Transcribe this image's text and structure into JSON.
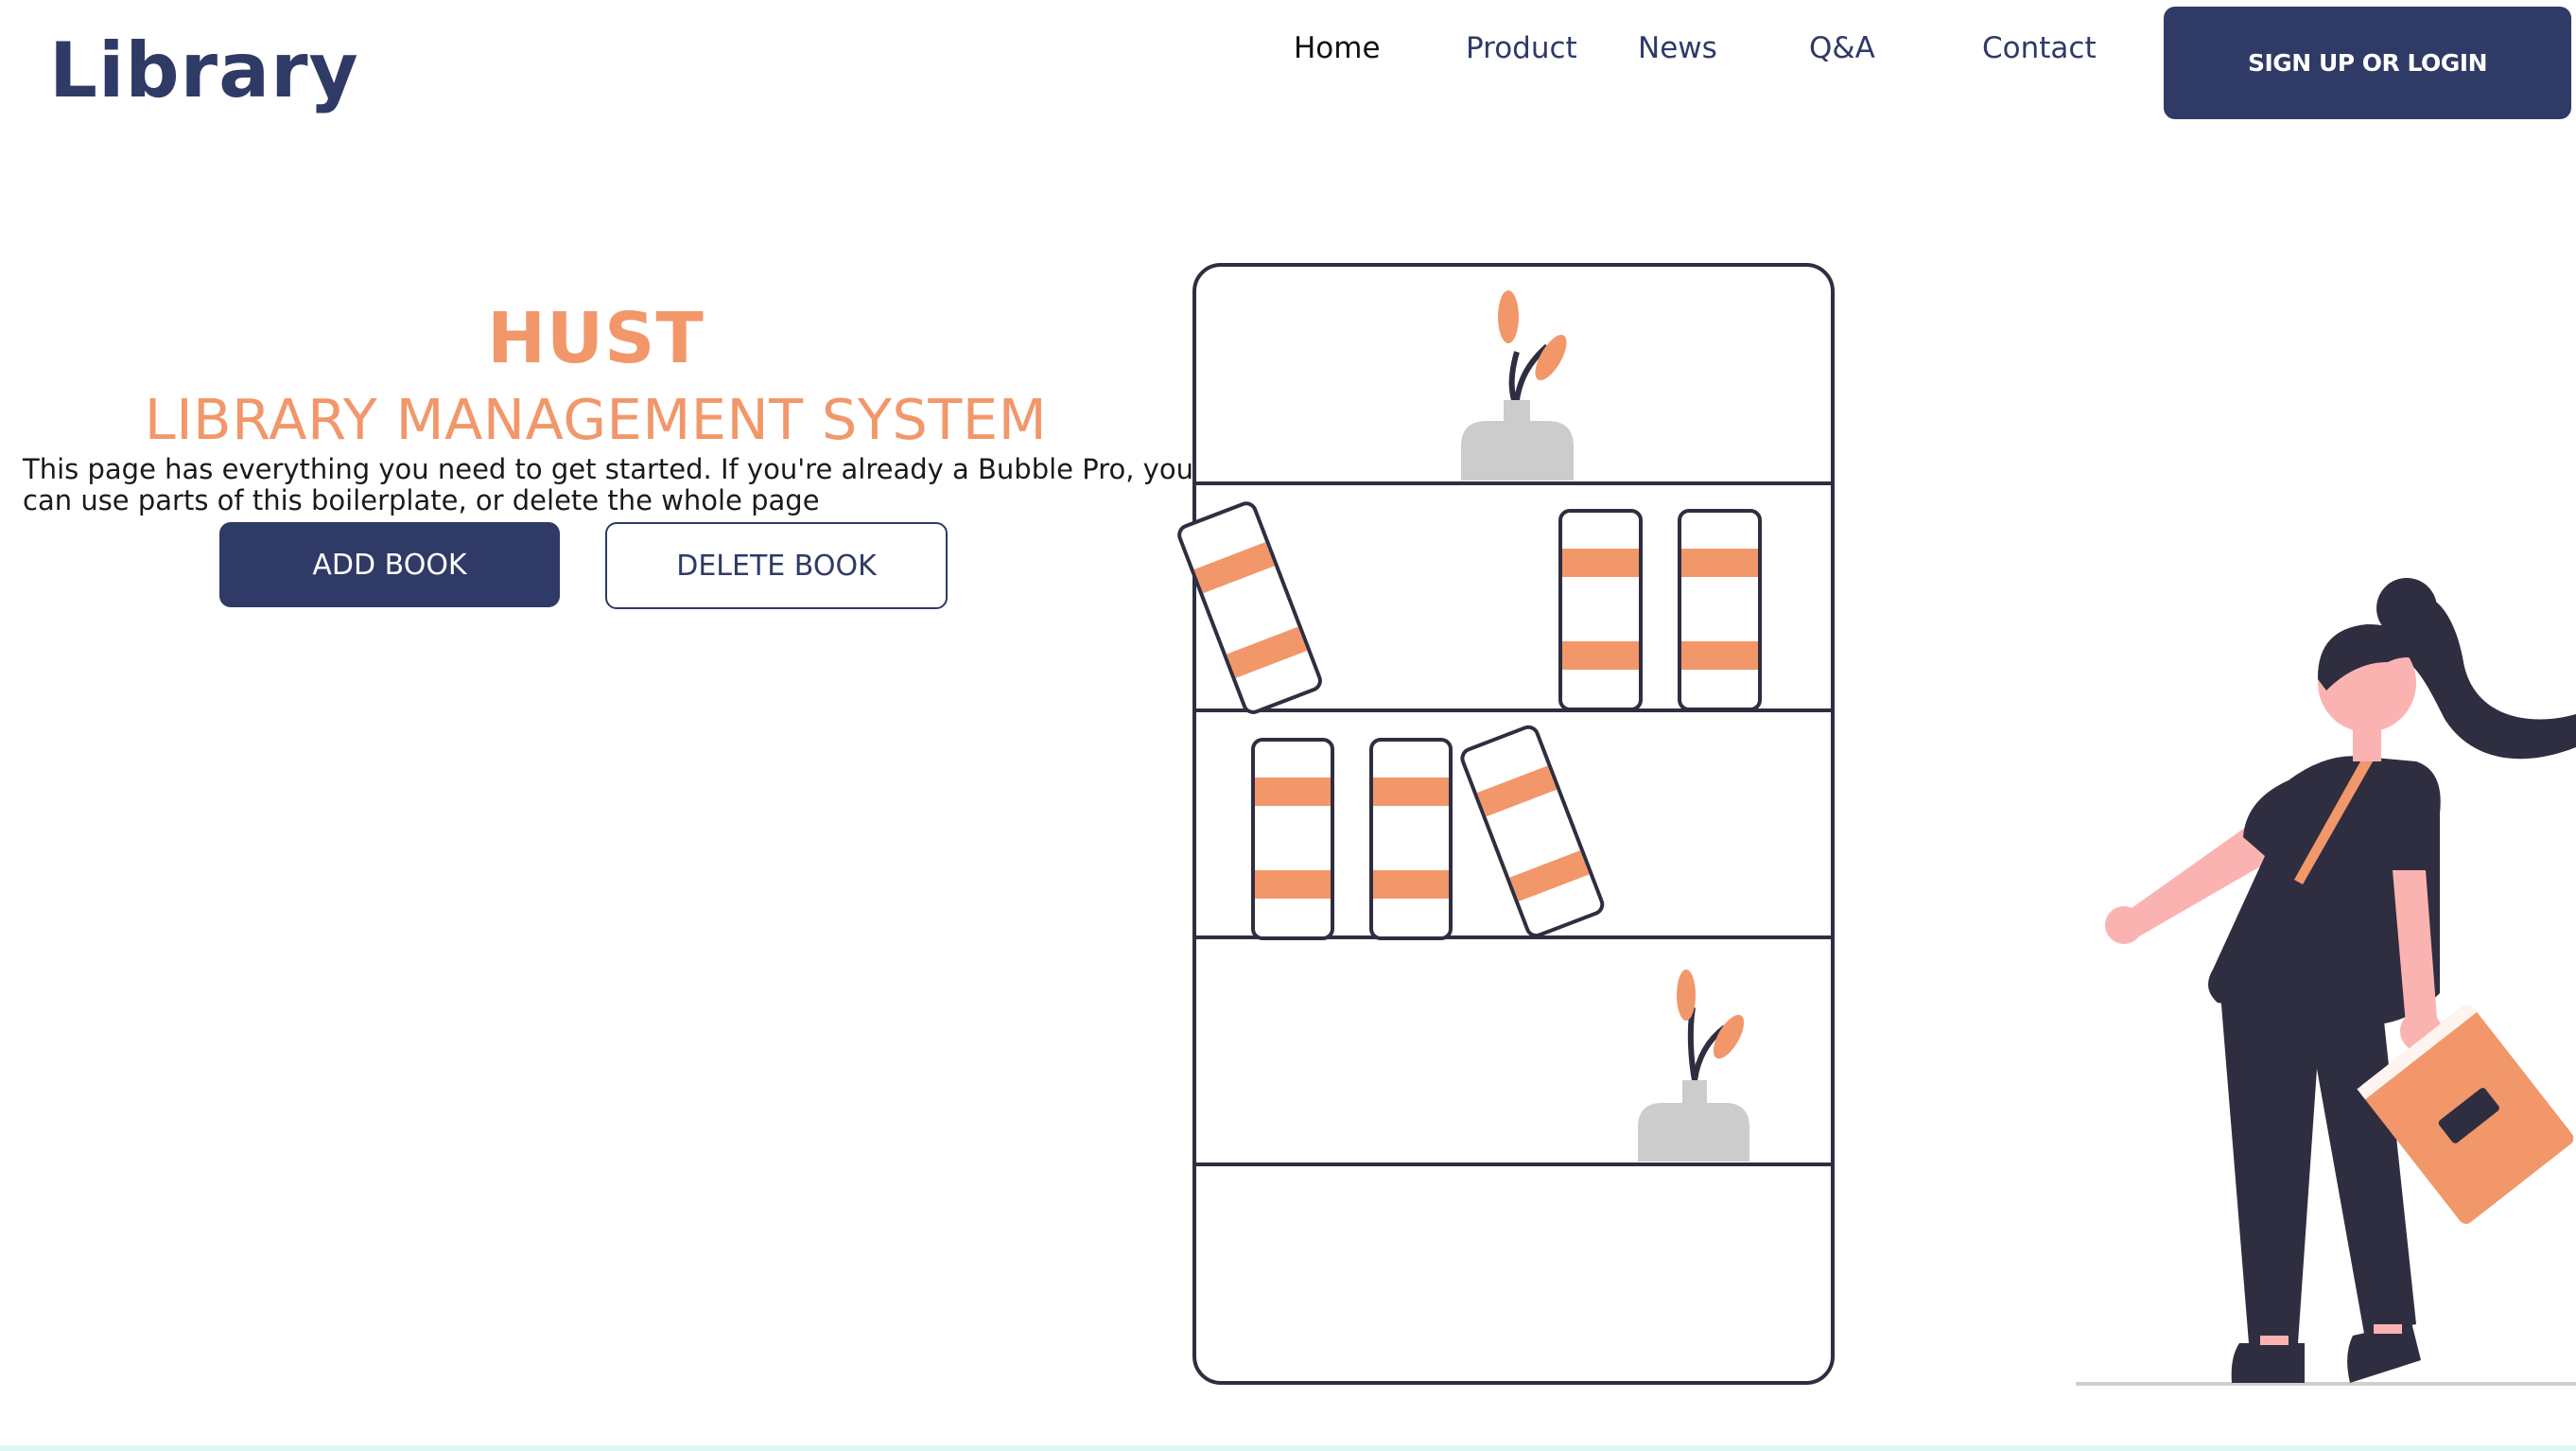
{
  "header": {
    "logo": "Library",
    "nav": [
      {
        "label": "Home",
        "active": true
      },
      {
        "label": "Product",
        "active": false
      },
      {
        "label": "News",
        "active": false
      },
      {
        "label": "Q&A",
        "active": false
      },
      {
        "label": "Contact",
        "active": false
      }
    ],
    "cta_label": "SIGN UP OR LOGIN"
  },
  "hero": {
    "title": "HUST",
    "subtitle": "LIBRARY MANAGEMENT SYSTEM",
    "description": "This page has everything you need to get started. If you're already a Bubble Pro, you can use parts of this boilerplate, or delete the whole page",
    "add_book_label": "ADD BOOK",
    "delete_book_label": "DELETE BOOK"
  },
  "colors": {
    "primary": "#2f3a66",
    "accent": "#f2976a",
    "skin": "#fbb3b2",
    "dark": "#2f2e41",
    "vase": "#cccccc"
  },
  "illustration": {
    "icons": [
      "bookshelf-illustration",
      "woman-with-book-illustration"
    ]
  }
}
